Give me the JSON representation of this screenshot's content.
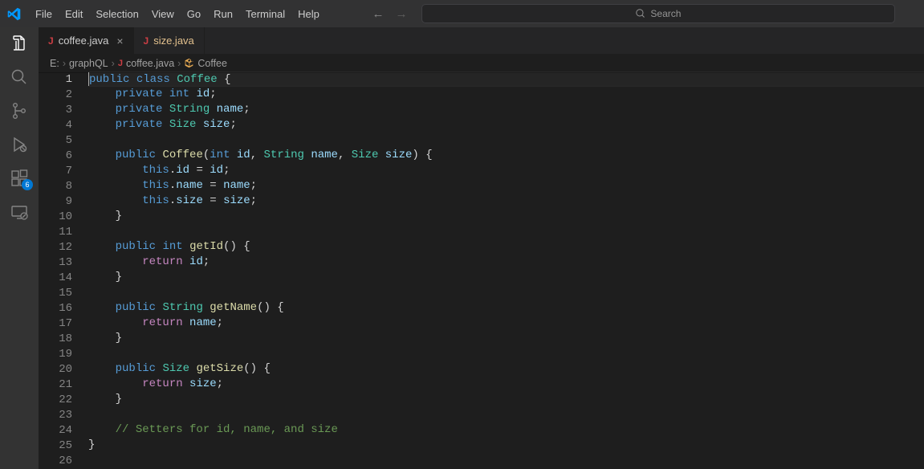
{
  "menu": {
    "items": [
      "File",
      "Edit",
      "Selection",
      "View",
      "Go",
      "Run",
      "Terminal",
      "Help"
    ]
  },
  "search": {
    "placeholder": "Search"
  },
  "activity": {
    "ext_badge": "6"
  },
  "tabs": [
    {
      "icon": "J",
      "name": "coffee.java",
      "active": true,
      "close": "×"
    },
    {
      "icon": "J",
      "name": "size.java",
      "active": false
    }
  ],
  "breadcrumbs": {
    "root": "E:",
    "folder": "graphQL",
    "file_icon": "J",
    "file": "coffee.java",
    "symbol": "Coffee"
  },
  "code": {
    "lines": [
      {
        "n": 1,
        "active": true,
        "tokens": [
          [
            "kw",
            "public"
          ],
          [
            "pun",
            " "
          ],
          [
            "kw",
            "class"
          ],
          [
            "pun",
            " "
          ],
          [
            "type",
            "Coffee"
          ],
          [
            "pun",
            " {"
          ]
        ]
      },
      {
        "n": 2,
        "tokens": [
          [
            "pun",
            "    "
          ],
          [
            "kw",
            "private"
          ],
          [
            "pun",
            " "
          ],
          [
            "kw",
            "int"
          ],
          [
            "pun",
            " "
          ],
          [
            "var",
            "id"
          ],
          [
            "pun",
            ";"
          ]
        ]
      },
      {
        "n": 3,
        "tokens": [
          [
            "pun",
            "    "
          ],
          [
            "kw",
            "private"
          ],
          [
            "pun",
            " "
          ],
          [
            "type",
            "String"
          ],
          [
            "pun",
            " "
          ],
          [
            "var",
            "name"
          ],
          [
            "pun",
            ";"
          ]
        ]
      },
      {
        "n": 4,
        "tokens": [
          [
            "pun",
            "    "
          ],
          [
            "kw",
            "private"
          ],
          [
            "pun",
            " "
          ],
          [
            "type",
            "Size"
          ],
          [
            "pun",
            " "
          ],
          [
            "var",
            "size"
          ],
          [
            "pun",
            ";"
          ]
        ]
      },
      {
        "n": 5,
        "tokens": []
      },
      {
        "n": 6,
        "tokens": [
          [
            "pun",
            "    "
          ],
          [
            "kw",
            "public"
          ],
          [
            "pun",
            " "
          ],
          [
            "fn",
            "Coffee"
          ],
          [
            "pun",
            "("
          ],
          [
            "kw",
            "int"
          ],
          [
            "pun",
            " "
          ],
          [
            "var",
            "id"
          ],
          [
            "pun",
            ", "
          ],
          [
            "type",
            "String"
          ],
          [
            "pun",
            " "
          ],
          [
            "var",
            "name"
          ],
          [
            "pun",
            ", "
          ],
          [
            "type",
            "Size"
          ],
          [
            "pun",
            " "
          ],
          [
            "var",
            "size"
          ],
          [
            "pun",
            ") {"
          ]
        ]
      },
      {
        "n": 7,
        "tokens": [
          [
            "pun",
            "        "
          ],
          [
            "kw",
            "this"
          ],
          [
            "pun",
            "."
          ],
          [
            "var",
            "id"
          ],
          [
            "pun",
            " = "
          ],
          [
            "var",
            "id"
          ],
          [
            "pun",
            ";"
          ]
        ]
      },
      {
        "n": 8,
        "tokens": [
          [
            "pun",
            "        "
          ],
          [
            "kw",
            "this"
          ],
          [
            "pun",
            "."
          ],
          [
            "var",
            "name"
          ],
          [
            "pun",
            " = "
          ],
          [
            "var",
            "name"
          ],
          [
            "pun",
            ";"
          ]
        ]
      },
      {
        "n": 9,
        "tokens": [
          [
            "pun",
            "        "
          ],
          [
            "kw",
            "this"
          ],
          [
            "pun",
            "."
          ],
          [
            "var",
            "size"
          ],
          [
            "pun",
            " = "
          ],
          [
            "var",
            "size"
          ],
          [
            "pun",
            ";"
          ]
        ]
      },
      {
        "n": 10,
        "tokens": [
          [
            "pun",
            "    }"
          ]
        ]
      },
      {
        "n": 11,
        "tokens": []
      },
      {
        "n": 12,
        "tokens": [
          [
            "pun",
            "    "
          ],
          [
            "kw",
            "public"
          ],
          [
            "pun",
            " "
          ],
          [
            "kw",
            "int"
          ],
          [
            "pun",
            " "
          ],
          [
            "fn",
            "getId"
          ],
          [
            "pun",
            "() {"
          ]
        ]
      },
      {
        "n": 13,
        "tokens": [
          [
            "pun",
            "        "
          ],
          [
            "ctl",
            "return"
          ],
          [
            "pun",
            " "
          ],
          [
            "var",
            "id"
          ],
          [
            "pun",
            ";"
          ]
        ]
      },
      {
        "n": 14,
        "tokens": [
          [
            "pun",
            "    }"
          ]
        ]
      },
      {
        "n": 15,
        "tokens": []
      },
      {
        "n": 16,
        "tokens": [
          [
            "pun",
            "    "
          ],
          [
            "kw",
            "public"
          ],
          [
            "pun",
            " "
          ],
          [
            "type",
            "String"
          ],
          [
            "pun",
            " "
          ],
          [
            "fn",
            "getName"
          ],
          [
            "pun",
            "() {"
          ]
        ]
      },
      {
        "n": 17,
        "tokens": [
          [
            "pun",
            "        "
          ],
          [
            "ctl",
            "return"
          ],
          [
            "pun",
            " "
          ],
          [
            "var",
            "name"
          ],
          [
            "pun",
            ";"
          ]
        ]
      },
      {
        "n": 18,
        "tokens": [
          [
            "pun",
            "    }"
          ]
        ]
      },
      {
        "n": 19,
        "tokens": []
      },
      {
        "n": 20,
        "tokens": [
          [
            "pun",
            "    "
          ],
          [
            "kw",
            "public"
          ],
          [
            "pun",
            " "
          ],
          [
            "type",
            "Size"
          ],
          [
            "pun",
            " "
          ],
          [
            "fn",
            "getSize"
          ],
          [
            "pun",
            "() {"
          ]
        ]
      },
      {
        "n": 21,
        "tokens": [
          [
            "pun",
            "        "
          ],
          [
            "ctl",
            "return"
          ],
          [
            "pun",
            " "
          ],
          [
            "var",
            "size"
          ],
          [
            "pun",
            ";"
          ]
        ]
      },
      {
        "n": 22,
        "tokens": [
          [
            "pun",
            "    }"
          ]
        ]
      },
      {
        "n": 23,
        "tokens": []
      },
      {
        "n": 24,
        "tokens": [
          [
            "pun",
            "    "
          ],
          [
            "cmt",
            "// Setters for id, name, and size"
          ]
        ]
      },
      {
        "n": 25,
        "tokens": [
          [
            "pun",
            "}"
          ]
        ]
      },
      {
        "n": 26,
        "tokens": []
      }
    ]
  }
}
